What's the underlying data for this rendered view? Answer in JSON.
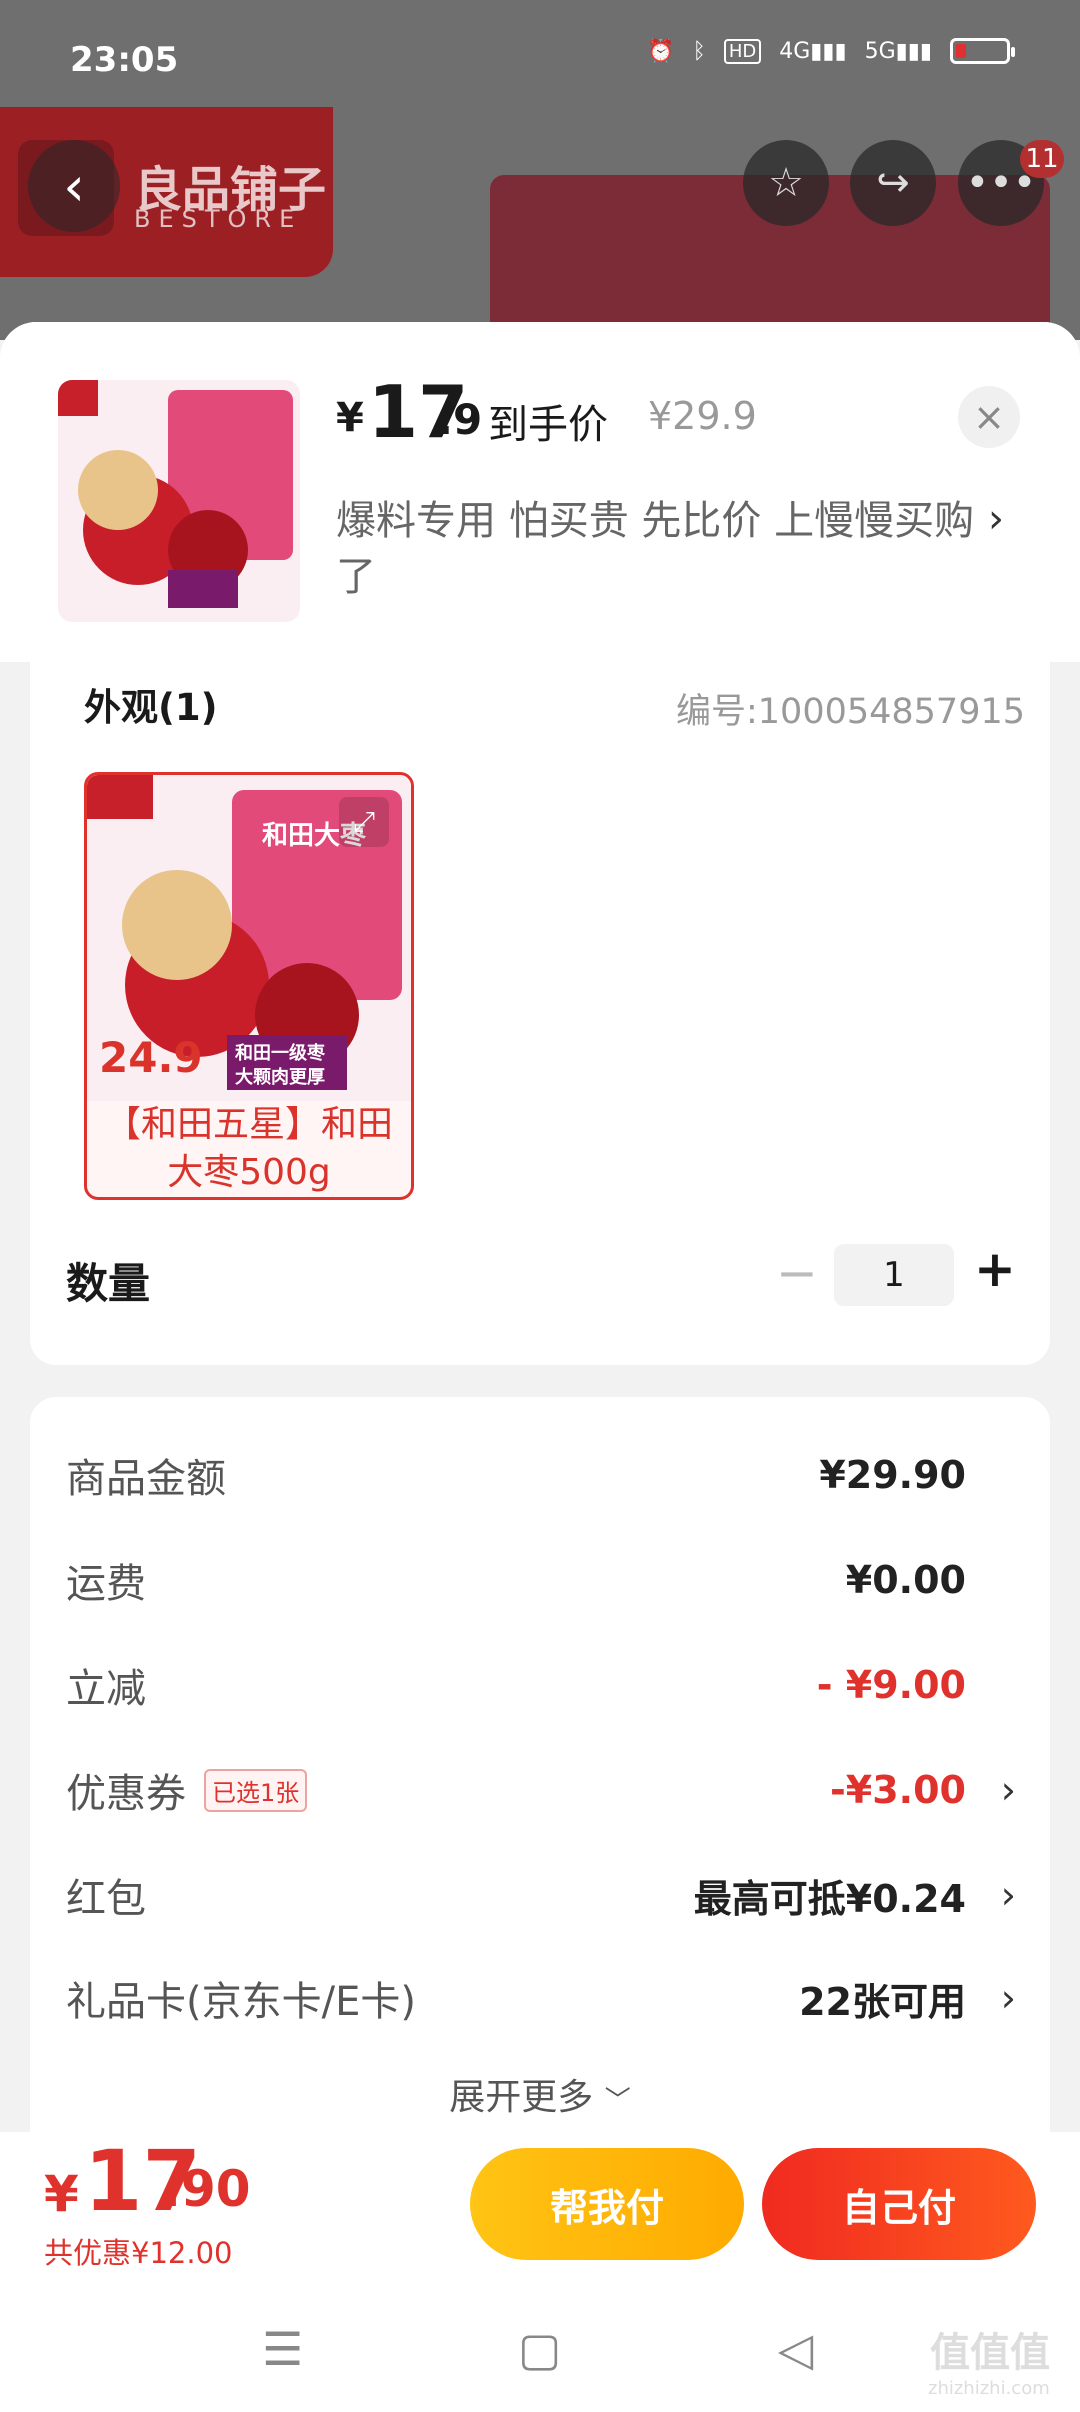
{
  "status_bar": {
    "time": "23:05",
    "icons": [
      "alarm-icon",
      "bluetooth-icon",
      "hd-icon",
      "4g-signal-icon",
      "5g-signal-icon",
      "battery-icon"
    ]
  },
  "background_page": {
    "brand_name": "良品铺子",
    "brand_sub": "BESTORE",
    "notification_count": "11"
  },
  "sheet_header": {
    "currency": "¥",
    "price_int": "17",
    "price_dec": ".9",
    "price_tag": "到手价",
    "original_price": "¥29.9",
    "promo_text": "爆料专用 怕买贵 先比价 上慢慢买购了"
  },
  "spec": {
    "appearance_label": "外观(1)",
    "sku_number": "编号:100054857915",
    "variant_label": "【和田五星】和田大枣500g",
    "package_price": "24.9",
    "package_title": "和田大枣",
    "package_slogan_1": "和田一级枣",
    "package_slogan_2": "大颗肉更厚"
  },
  "quantity": {
    "label": "数量",
    "value": "1",
    "minus": "−",
    "plus": "+"
  },
  "summary": {
    "rows": [
      {
        "label": "商品金额",
        "value": "¥29.90"
      },
      {
        "label": "运费",
        "value": "¥0.00"
      },
      {
        "label": "立减",
        "value": "- ¥9.00"
      },
      {
        "label": "优惠券",
        "tag": "已选1张",
        "value": "-¥3.00"
      },
      {
        "label": "红包",
        "value": "最高可抵¥0.24"
      },
      {
        "label": "礼品卡(京东卡/E卡)",
        "value": "22张可用"
      }
    ],
    "expand_more": "展开更多"
  },
  "footer": {
    "currency": "¥",
    "total_int": "17",
    "total_dec": ".90",
    "saved_text": "共优惠¥12.00",
    "help_pay_label": "帮我付",
    "self_pay_label": "自己付"
  },
  "watermark": {
    "text": "值值值",
    "sub": "zhizhizhi.com"
  },
  "colors": {
    "accent_red": "#e0322c",
    "help_yellow": "#ffb800",
    "self_red": "#f03a20"
  }
}
